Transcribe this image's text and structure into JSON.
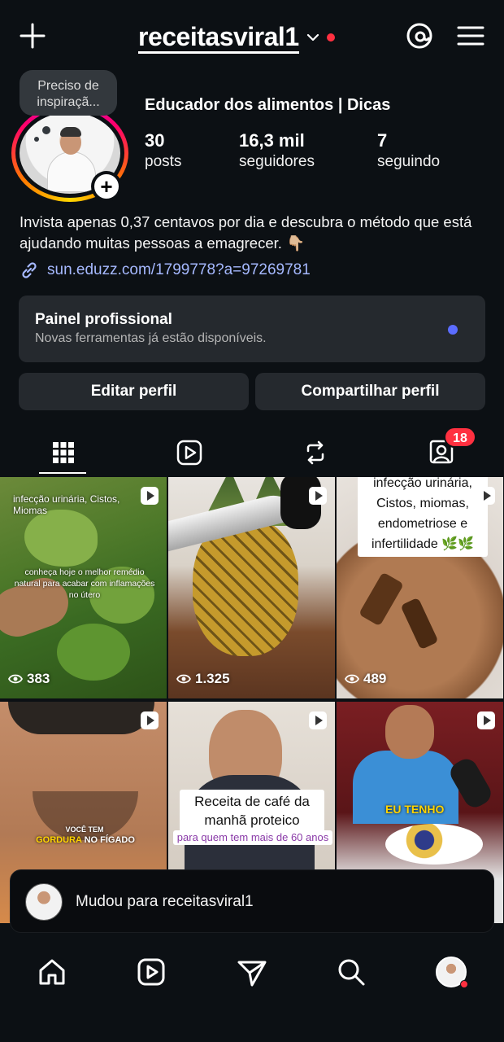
{
  "header": {
    "username": "receitasviral1",
    "add_icon": "plus-icon",
    "threads_icon": "threads-icon",
    "menu_icon": "hamburger-menu-icon"
  },
  "profile": {
    "note": "Preciso de inspiraçã...",
    "display_name": "Educador dos alimentos | Dicas",
    "stats": [
      {
        "value": "30",
        "label": "posts"
      },
      {
        "value": "16,3 mil",
        "label": "seguidores"
      },
      {
        "value": "7",
        "label": "seguindo"
      }
    ],
    "bio": "Invista apenas 0,37 centavos por dia e descubra o método que está ajudando muitas pessoas a emagrecer. 👇🏼",
    "link": "sun.eduzz.com/1799778?a=97269781"
  },
  "pro_panel": {
    "title": "Painel profissional",
    "subtitle": "Novas ferramentas já estão disponíveis."
  },
  "buttons": {
    "edit": "Editar perfil",
    "share": "Compartilhar perfil"
  },
  "tabs": {
    "items": [
      "grid-icon",
      "reels-icon",
      "reposts-icon",
      "tagged-icon"
    ],
    "tagged_badge": "18"
  },
  "posts": [
    {
      "views": "383",
      "caption_top": "infecção urinária, Cistos, Miomas",
      "caption_mid": "conheça hoje o melhor remédio natural para acabar com inflamações no útero"
    },
    {
      "views": "1.325"
    },
    {
      "views": "489",
      "caption": "infecção urinária, Cistos, miomas, endometriose e infertilidade 🌿🌿"
    },
    {
      "caption_a": "VOCÊ TEM",
      "caption_b": "GORDURA",
      "caption_c": "NO FÍGADO"
    },
    {
      "caption": "Receita de café da manhã proteico",
      "caption_sub": "para quem tem mais de 60 anos"
    },
    {
      "caption": "EU TENHO"
    }
  ],
  "toast": {
    "message": "Mudou para receitasviral1"
  },
  "bottom_nav": [
    "home-icon",
    "reels-icon",
    "direct-icon",
    "search-icon",
    "profile-avatar"
  ],
  "colors": {
    "background": "#0c1014",
    "panel": "#25292e",
    "link": "#a6b9ff",
    "notification": "#ff3040"
  }
}
